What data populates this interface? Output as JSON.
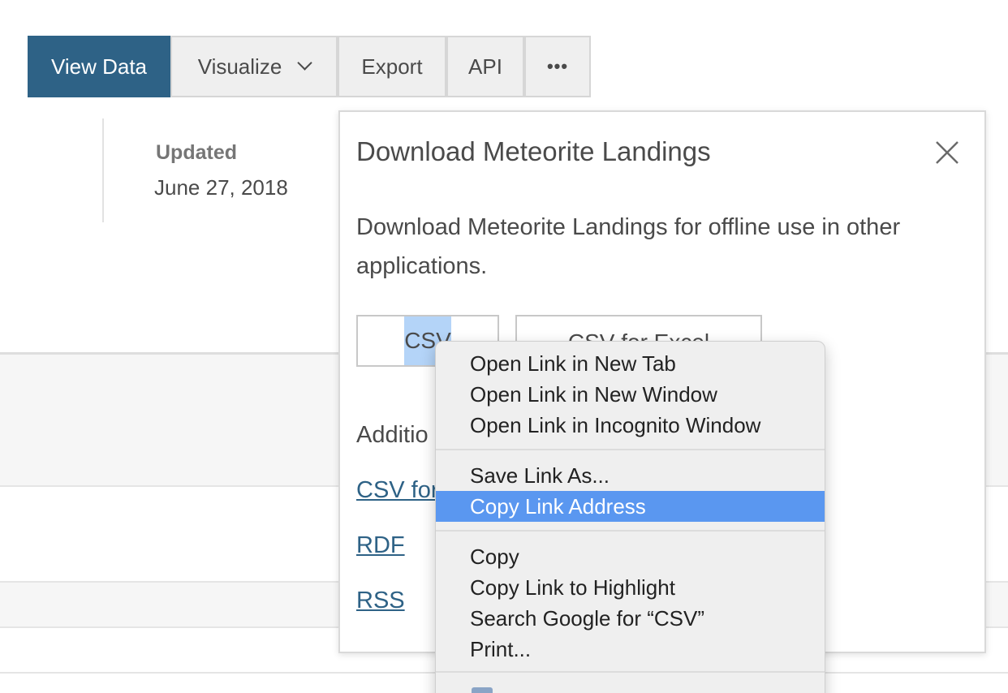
{
  "toolbar": {
    "view_data": "View Data",
    "visualize": "Visualize",
    "export": "Export",
    "api": "API",
    "more": "•••"
  },
  "meta": {
    "updated_label": "Updated",
    "updated_date": "June 27, 2018"
  },
  "dialog": {
    "title": "Download Meteorite Landings",
    "description": "Download Meteorite Landings for offline use in other applications.",
    "formats": [
      "CSV",
      "CSV for Excel"
    ],
    "additional_label": "Additio",
    "links": [
      "CSV for",
      "RDF",
      "RSS"
    ]
  },
  "context_menu": {
    "group1": [
      "Open Link in New Tab",
      "Open Link in New Window",
      "Open Link in Incognito Window"
    ],
    "group2": [
      "Save Link As...",
      "Copy Link Address"
    ],
    "group3": [
      "Copy",
      "Copy Link to Highlight",
      "Search Google for “CSV”",
      "Print..."
    ],
    "highlighted": "Copy Link Address"
  },
  "colors": {
    "primary": "#2e6286",
    "menu_highlight": "#5a97f0",
    "link": "#2e6286",
    "selection": "#b4d4f8"
  }
}
